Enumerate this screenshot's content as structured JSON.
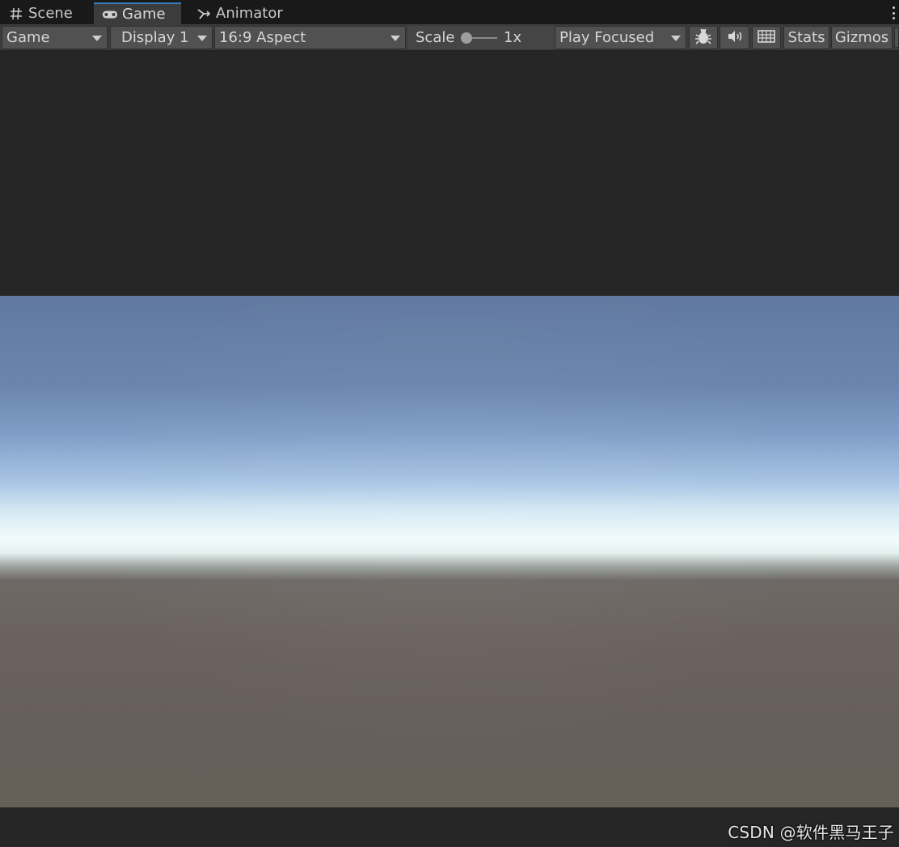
{
  "tabs": [
    {
      "label": "Scene",
      "icon": "grid-icon",
      "active": false
    },
    {
      "label": "Game",
      "icon": "gamepad-icon",
      "active": true
    },
    {
      "label": "Animator",
      "icon": "animator-icon",
      "active": false
    }
  ],
  "toolbar": {
    "view_mode": "Game",
    "display": "Display 1",
    "aspect": "16:9 Aspect",
    "scale_label": "Scale",
    "scale_value": "1x",
    "play_mode": "Play Focused",
    "stats_label": "Stats",
    "gizmos_label": "Gizmos"
  },
  "watermark": "CSDN @软件黑马王子",
  "colors": {
    "active_tab_accent": "#3a79bb",
    "toolbar_bg": "#3c3c3c",
    "panel_bg": "#262626"
  }
}
